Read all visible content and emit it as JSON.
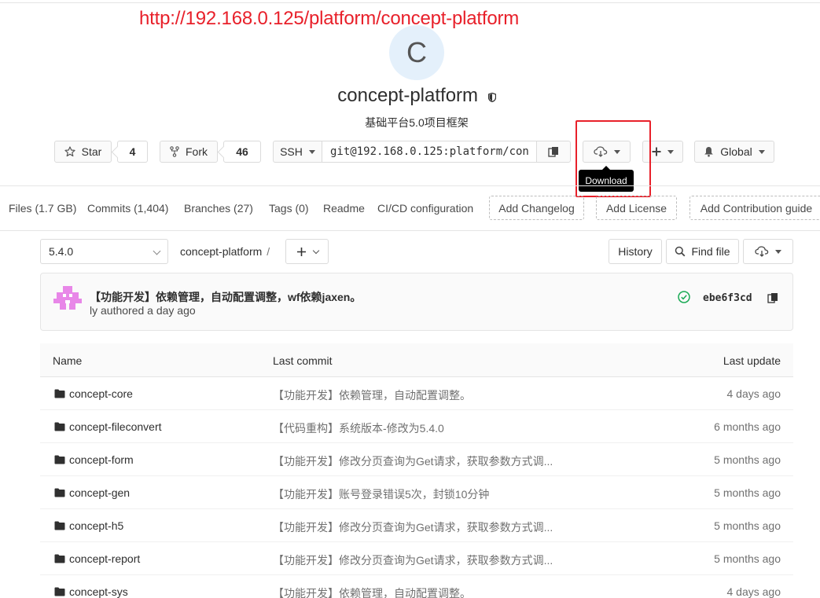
{
  "annotation": {
    "url": "http://192.168.0.125/platform/concept-platform"
  },
  "project": {
    "avatar_letter": "C",
    "name": "concept-platform",
    "description": "基础平台5.0项目框架"
  },
  "actions": {
    "star_label": "Star",
    "star_count": "4",
    "fork_label": "Fork",
    "fork_count": "46",
    "clone_protocol": "SSH",
    "clone_url": "git@192.168.0.125:platform/con",
    "download_tooltip": "Download",
    "notification_label": "Global"
  },
  "nav": {
    "files": "Files (1.7 GB)",
    "commits": "Commits (1,404)",
    "branches": "Branches (27)",
    "tags": "Tags (0)",
    "readme": "Readme",
    "cicd": "CI/CD configuration",
    "add_changelog": "Add Changelog",
    "add_license": "Add License",
    "add_contribution": "Add Contribution guide"
  },
  "repo": {
    "branch": "5.4.0",
    "path": "concept-platform",
    "path_sep": "/",
    "history_label": "History",
    "find_file_label": "Find file"
  },
  "last_commit": {
    "title": "【功能开发】依赖管理，自动配置调整，wf依赖jaxen。",
    "meta": "ly authored a day ago",
    "sha": "ebe6f3cd"
  },
  "table": {
    "headers": {
      "name": "Name",
      "last_commit": "Last commit",
      "last_update": "Last update"
    },
    "rows": [
      {
        "name": "concept-core",
        "message": "【功能开发】依赖管理，自动配置调整。",
        "updated": "4 days ago"
      },
      {
        "name": "concept-fileconvert",
        "message": "【代码重构】系统版本-修改为5.4.0",
        "updated": "6 months ago"
      },
      {
        "name": "concept-form",
        "message": "【功能开发】修改分页查询为Get请求，获取参数方式调...",
        "updated": "5 months ago"
      },
      {
        "name": "concept-gen",
        "message": "【功能开发】账号登录错误5次，封锁10分钟",
        "updated": "5 months ago"
      },
      {
        "name": "concept-h5",
        "message": "【功能开发】修改分页查询为Get请求，获取参数方式调...",
        "updated": "5 months ago"
      },
      {
        "name": "concept-report",
        "message": "【功能开发】修改分页查询为Get请求，获取参数方式调...",
        "updated": "5 months ago"
      },
      {
        "name": "concept-sys",
        "message": "【功能开发】依赖管理，自动配置调整。",
        "updated": "4 days ago"
      }
    ]
  },
  "colors": {
    "annotation_red": "#e8202a",
    "status_green": "#1aaa55",
    "avatar_bg": "#e4f0fb"
  }
}
